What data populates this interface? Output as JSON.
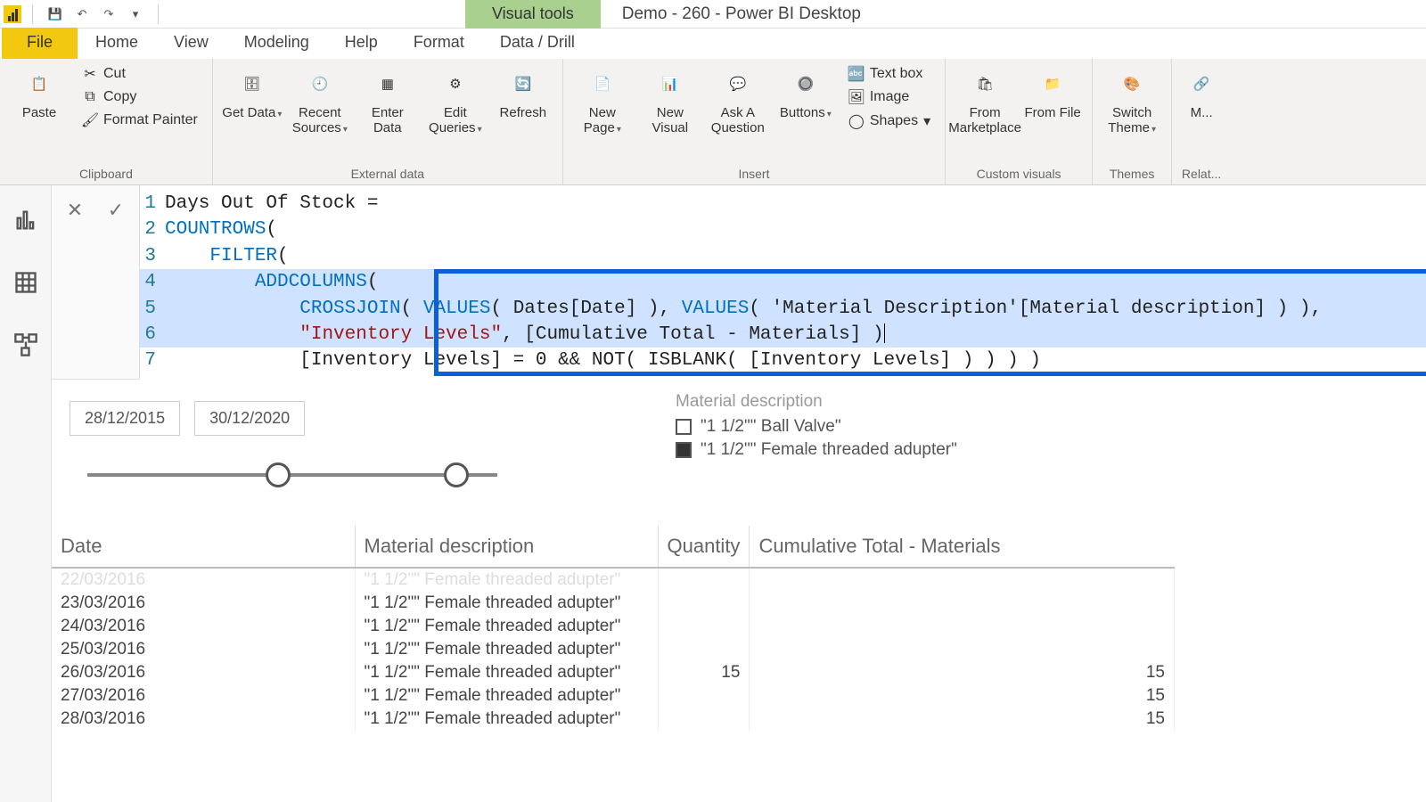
{
  "app": {
    "contextual_tab": "Visual tools",
    "title": "Demo - 260 - Power BI Desktop"
  },
  "tabs": {
    "file": "File",
    "home": "Home",
    "view": "View",
    "modeling": "Modeling",
    "help": "Help",
    "format": "Format",
    "datadrill": "Data / Drill"
  },
  "ribbon": {
    "paste": "Paste",
    "cut": "Cut",
    "copy": "Copy",
    "format_painter": "Format Painter",
    "clipboard": "Clipboard",
    "get_data": "Get Data",
    "recent_sources": "Recent Sources",
    "enter_data": "Enter Data",
    "edit_queries": "Edit Queries",
    "refresh": "Refresh",
    "external_data": "External data",
    "new_page": "New Page",
    "new_visual": "New Visual",
    "ask_question": "Ask A Question",
    "buttons": "Buttons",
    "text_box": "Text box",
    "image": "Image",
    "shapes": "Shapes",
    "insert": "Insert",
    "from_marketplace": "From Marketplace",
    "from_file": "From File",
    "custom_visuals": "Custom visuals",
    "switch_theme": "Switch Theme",
    "themes": "Themes",
    "relationships": "Manage Relationships",
    "relat_group": "Relationships"
  },
  "formula": {
    "l1": "Days Out Of Stock =",
    "l2a": "COUNTROWS",
    "l2b": "(",
    "l3a": "FILTER",
    "l3b": "(",
    "l4a": "ADDCOLUMNS",
    "l4b": "(",
    "l5a": "CROSSJOIN",
    "l5b": "( ",
    "l5c": "VALUES",
    "l5d": "( Dates[Date] ), ",
    "l5e": "VALUES",
    "l5f": "( 'Material Description'[Material description] ) ),",
    "l6a": "\"Inventory Levels\"",
    "l6b": ", [Cumulative Total - Materials] )",
    "l7": "            [Inventory Levels] = 0 && NOT( ISBLANK( [Inventory Levels] ) ) ) )"
  },
  "slicer": {
    "start": "28/12/2015",
    "end": "30/12/2020"
  },
  "legend": {
    "title": "Material description",
    "i1": "\"1 1/2\"\" Ball Valve\"",
    "i2": "\"1 1/2\"\" Female threaded adupter\""
  },
  "table": {
    "h1": "Date",
    "h2": "Material description",
    "h3": "Quantity",
    "h4": "Cumulative Total - Materials",
    "rows": [
      {
        "d": "22/03/2016",
        "m": "\"1 1/2\"\" Female threaded adupter\"",
        "q": "",
        "c": ""
      },
      {
        "d": "23/03/2016",
        "m": "\"1 1/2\"\" Female threaded adupter\"",
        "q": "",
        "c": ""
      },
      {
        "d": "24/03/2016",
        "m": "\"1 1/2\"\" Female threaded adupter\"",
        "q": "",
        "c": ""
      },
      {
        "d": "25/03/2016",
        "m": "\"1 1/2\"\" Female threaded adupter\"",
        "q": "",
        "c": ""
      },
      {
        "d": "26/03/2016",
        "m": "\"1 1/2\"\" Female threaded adupter\"",
        "q": "15",
        "c": "15"
      },
      {
        "d": "27/03/2016",
        "m": "\"1 1/2\"\" Female threaded adupter\"",
        "q": "",
        "c": "15"
      },
      {
        "d": "28/03/2016",
        "m": "\"1 1/2\"\" Female threaded adupter\"",
        "q": "",
        "c": "15"
      }
    ]
  }
}
